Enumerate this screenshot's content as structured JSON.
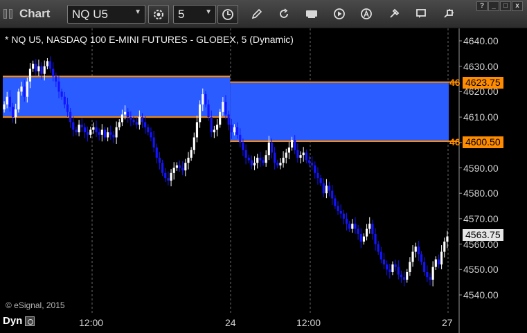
{
  "toolbar": {
    "title": "Chart",
    "symbol": "NQ U5",
    "interval": "5",
    "icons": [
      "settings-gear-icon",
      "clock-icon",
      "draw-pencil-icon",
      "refresh-icon",
      "quote-icon",
      "play-icon",
      "alert-icon",
      "tools-icon",
      "chat-icon",
      "link-icon"
    ],
    "window_help": "?",
    "window_min": "_",
    "window_max": "□",
    "window_close": "x"
  },
  "chart": {
    "header": "* NQ U5, NASDAQ 100 E-MINI FUTURES - GLOBEX, 5 (Dynamic)",
    "copyright": "© eSignal, 2015",
    "y_ticks": [
      "4640.00",
      "4630.00",
      "4620.00",
      "4610.00",
      "4600.00",
      "4590.00",
      "4580.00",
      "4570.00",
      "4560.00",
      "4550.00",
      "4540.00"
    ],
    "x_ticks": [
      "12:00",
      "24",
      "12:00",
      "27"
    ],
    "tags": {
      "upper_level": "4623.75",
      "lower_level": "4600.50",
      "last_price": "4563.75",
      "stub": "46"
    },
    "dyn_label": "Dyn",
    "colors": {
      "zone": "#2b5cff",
      "zone_edge": "#ff8c00",
      "candle_up": "#ffffff",
      "candle_down": "#1414ff"
    }
  },
  "chart_data": {
    "type": "candlestick",
    "y_range": [
      4537,
      4642
    ],
    "zones": [
      {
        "from_bar": 0,
        "to_bar": 79,
        "low": 4610,
        "high": 4626
      },
      {
        "from_bar": 79,
        "to_bar": 155,
        "low": 4600.5,
        "high": 4623.75
      }
    ],
    "close_series": [
      4615,
      4618,
      4614,
      4610,
      4613,
      4620,
      4622,
      4618,
      4624,
      4629,
      4631,
      4628,
      4630,
      4627,
      4630,
      4632,
      4629,
      4626,
      4624,
      4620,
      4618,
      4615,
      4612,
      4608,
      4605,
      4604,
      4607,
      4606,
      4604,
      4603,
      4605,
      4606,
      4604,
      4603,
      4605,
      4602,
      4604,
      4603,
      4602,
      4606,
      4608,
      4611,
      4612,
      4610,
      4609,
      4608,
      4607,
      4610,
      4608,
      4606,
      4604,
      4602,
      4598,
      4594,
      4592,
      4588,
      4586,
      4585,
      4588,
      4590,
      4591,
      4590,
      4589,
      4592,
      4594,
      4597,
      4602,
      4608,
      4615,
      4619,
      4615,
      4610,
      4604,
      4605,
      4607,
      4612,
      4616,
      4611,
      4607,
      4604,
      4606,
      4603,
      4600,
      4597,
      4594,
      4593,
      4591,
      4592,
      4594,
      4593,
      4592,
      4595,
      4600,
      4596,
      4592,
      4591,
      4592,
      4594,
      4596,
      4598,
      4601,
      4597,
      4594,
      4595,
      4596,
      4593,
      4592,
      4591,
      4588,
      4586,
      4584,
      4580,
      4583,
      4581,
      4578,
      4575,
      4573,
      4572,
      4570,
      4568,
      4566,
      4568,
      4566,
      4564,
      4561,
      4563,
      4566,
      4568,
      4564,
      4560,
      4557,
      4554,
      4552,
      4550,
      4549,
      4552,
      4551,
      4548,
      4547,
      4546,
      4549,
      4553,
      4557,
      4559,
      4556,
      4553,
      4549,
      4547,
      4546,
      4551,
      4554,
      4552,
      4557,
      4561,
      4563
    ],
    "last": 4563.75
  }
}
